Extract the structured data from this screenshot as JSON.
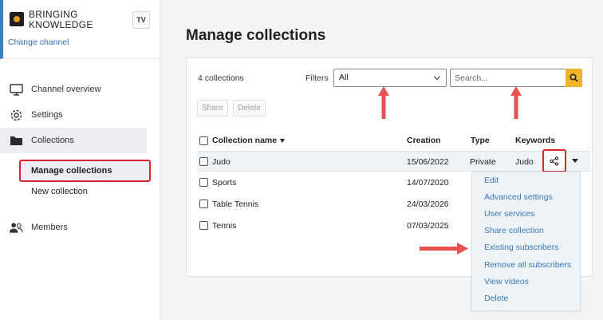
{
  "sidebar": {
    "brand_line1": "BRINGING",
    "brand_line2": "KNOWLEDGE",
    "badge": "TV",
    "change_channel": "Change channel",
    "items": [
      {
        "label": "Channel overview",
        "icon": "monitor-icon"
      },
      {
        "label": "Settings",
        "icon": "gear-icon"
      },
      {
        "label": "Collections",
        "icon": "folder-icon"
      },
      {
        "label": "Members",
        "icon": "users-icon"
      }
    ],
    "sub_items": [
      {
        "label": "Manage collections"
      },
      {
        "label": "New collection"
      }
    ]
  },
  "main": {
    "title": "Manage collections",
    "count": "4 collections",
    "filters_label": "Filters",
    "filter_value": "All",
    "search_placeholder": "Search...",
    "share_button": "Share",
    "delete_button": "Delete",
    "columns": {
      "name": "Collection name",
      "creation": "Creation",
      "type": "Type",
      "keywords": "Keywords"
    },
    "rows": [
      {
        "name": "Judo",
        "creation": "15/06/2022",
        "type": "Private",
        "keywords": "Judo"
      },
      {
        "name": "Sports",
        "creation": "14/07/2020",
        "type": "",
        "keywords": ""
      },
      {
        "name": "Table Tennis",
        "creation": "24/03/2026",
        "type": "",
        "keywords": ""
      },
      {
        "name": "Tennis",
        "creation": "07/03/2025",
        "type": "",
        "keywords": ""
      }
    ]
  },
  "menu": {
    "items": [
      {
        "label": "Edit"
      },
      {
        "label": "Advanced settings"
      },
      {
        "label": "User services"
      },
      {
        "label": "Share collection"
      },
      {
        "label": "Existing subscribers"
      },
      {
        "label": "Remove all subscribers"
      },
      {
        "label": "View videos"
      },
      {
        "label": "Delete"
      }
    ]
  },
  "colors": {
    "accent_red": "#d9262c",
    "link_blue": "#3a78b8",
    "search_yellow": "#f0b42a",
    "annotation_arrow": "#e8514f"
  }
}
